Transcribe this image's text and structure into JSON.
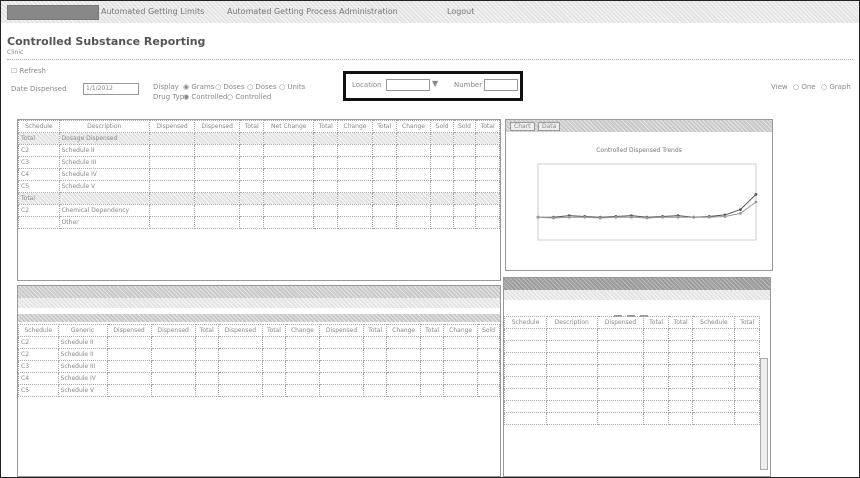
{
  "topbar": {
    "app_name": "",
    "nav": [
      "Automated Getting Limits",
      "Automated Getting Process Administration",
      "Logout"
    ]
  },
  "page": {
    "title": "Controlled Substance Reporting",
    "subtitle": "Clinic"
  },
  "filters": {
    "refresh_label": "Refresh",
    "date_label": "Date Dispensed",
    "date_value": "1/1/2012",
    "display_label": "Display",
    "display_options": [
      "Grams",
      "Doses",
      "Doses",
      "Units"
    ],
    "drug_type_label": "Drug Type",
    "drug_type_options": [
      "Controlled",
      "Controlled"
    ],
    "location_label": "Location",
    "location_value": "",
    "number_label": "Number",
    "number_value": "",
    "view_label": "View",
    "view_options": [
      "One",
      "Graph"
    ]
  },
  "top_table": {
    "headers": [
      "Schedule",
      "Description",
      "Dispensed",
      "Dispensed",
      "Total",
      "Net Change",
      "Total",
      "Change",
      "Total",
      "Change",
      "Sold",
      "Sold",
      "Total"
    ],
    "rows": [
      [
        "Total",
        "Dosage Dispensed",
        "",
        "",
        "",
        "",
        "",
        "",
        "",
        "",
        "",
        "",
        ""
      ],
      [
        "C2",
        "Schedule II",
        "",
        "",
        "",
        "",
        "",
        "",
        "",
        "",
        "",
        "",
        ""
      ],
      [
        "C3",
        "Schedule III",
        "",
        "",
        "",
        "",
        "",
        "",
        "",
        "",
        "",
        "",
        ""
      ],
      [
        "C4",
        "Schedule IV",
        "",
        "",
        "",
        "",
        "",
        "",
        "",
        "",
        "",
        "",
        ""
      ],
      [
        "C5",
        "Schedule V",
        "",
        "",
        "",
        "",
        "",
        "",
        "",
        "",
        "",
        "",
        ""
      ],
      [
        "Total",
        "",
        "",
        "",
        "",
        "",
        "",
        "",
        "",
        "",
        "",
        "",
        ""
      ],
      [
        "C2",
        "Chemical Dependency",
        "",
        "",
        "",
        "",
        "",
        "",
        "",
        "",
        "",
        "",
        ""
      ],
      [
        "",
        "Other",
        "",
        "",
        "",
        "",
        "",
        "",
        "",
        "",
        "",
        "",
        ""
      ]
    ]
  },
  "chart_tabs": [
    "Chart",
    "Data"
  ],
  "chart_data": {
    "type": "line",
    "title": "Controlled Dispensed Trends",
    "series": [
      {
        "name": "",
        "values": [
          3,
          3,
          3.2,
          3.1,
          3,
          3.1,
          3.2,
          3,
          3.1,
          3.2,
          3,
          3.1,
          3.3,
          4,
          6
        ]
      },
      {
        "name": "",
        "values": [
          3,
          2.9,
          3,
          3,
          2.9,
          3,
          3,
          2.9,
          3,
          3,
          3,
          3,
          3.1,
          3.5,
          5
        ]
      }
    ],
    "ylim": [
      0,
      10
    ],
    "legend_position": "top"
  },
  "chart_footer": "",
  "bottom_left": {
    "header": "",
    "filter_label": "",
    "headers": [
      "Schedule",
      "Generic",
      "Dispensed",
      "Dispensed",
      "Total",
      "Dispensed",
      "Total",
      "Change",
      "Dispensed",
      "Total",
      "Change",
      "Total",
      "Change",
      "Sold"
    ],
    "rows": [
      [
        "C2",
        "Schedule II"
      ],
      [
        "C2",
        "Schedule II"
      ],
      [
        "C3",
        "Schedule III"
      ],
      [
        "C4",
        "Schedule IV"
      ],
      [
        "C5",
        "Schedule V"
      ]
    ]
  },
  "bottom_right": {
    "header": "",
    "sub_header": "",
    "tabs": [
      "",
      "",
      ""
    ],
    "headers": [
      "Schedule",
      "Description",
      "Dispensed",
      "Total",
      "Total",
      "Schedule",
      "Total"
    ],
    "rows": [
      [
        "",
        "",
        "",
        "",
        "",
        "",
        ""
      ],
      [
        "",
        "",
        "",
        "",
        "",
        "",
        ""
      ],
      [
        "",
        "",
        "",
        "",
        "",
        "",
        ""
      ],
      [
        "",
        "",
        "",
        "",
        "",
        "",
        ""
      ],
      [
        "",
        "",
        "",
        "",
        "",
        "",
        ""
      ],
      [
        "",
        "",
        "",
        "",
        "",
        "",
        ""
      ],
      [
        "",
        "",
        "",
        "",
        "",
        "",
        ""
      ],
      [
        "",
        "",
        "",
        "",
        "",
        "",
        ""
      ]
    ]
  }
}
